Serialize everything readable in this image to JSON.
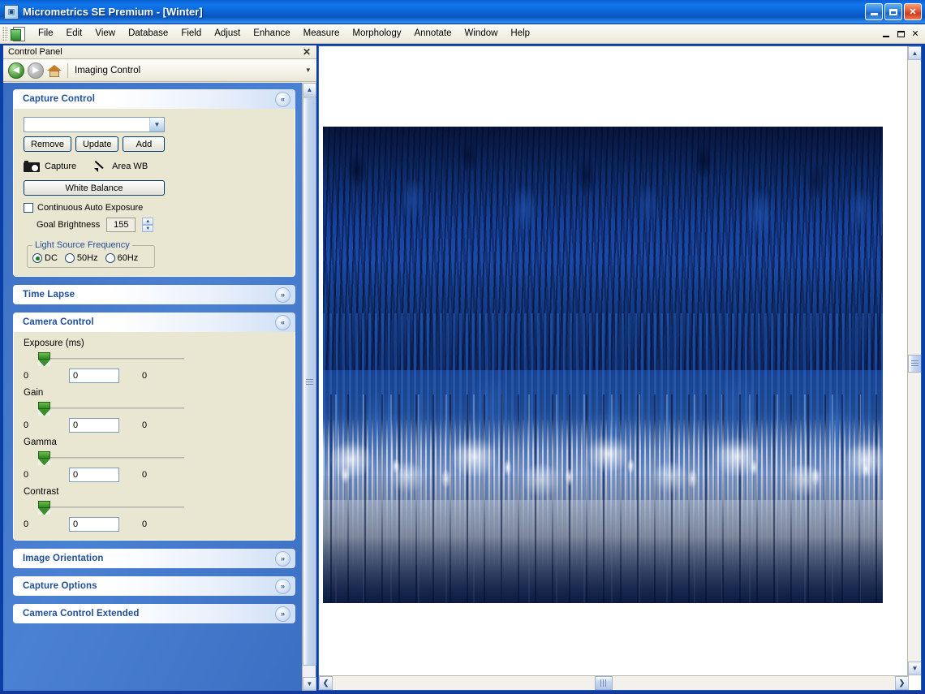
{
  "window": {
    "title": "Micrometrics SE Premium - [Winter]",
    "app_icon": "app-document-icon",
    "minimize_label": "",
    "maximize_label": "",
    "close_label": "✕"
  },
  "menubar": {
    "items": [
      {
        "label": "File"
      },
      {
        "label": "Edit"
      },
      {
        "label": "View"
      },
      {
        "label": "Database"
      },
      {
        "label": "Field"
      },
      {
        "label": "Adjust"
      },
      {
        "label": "Enhance"
      },
      {
        "label": "Measure"
      },
      {
        "label": "Morphology"
      },
      {
        "label": "Annotate"
      },
      {
        "label": "Window"
      },
      {
        "label": "Help"
      }
    ],
    "mdi_buttons": {
      "minimize": "",
      "restore": "",
      "close": "✕"
    }
  },
  "control_panel": {
    "title": "Control Panel",
    "close_label": "✕",
    "toolbar": {
      "back_label": "◀",
      "forward_label": "▶",
      "home_label": "",
      "current_view": "Imaging Control",
      "dropdown_caret": "▾"
    },
    "groups": [
      {
        "title": "Capture Control",
        "expanded": true,
        "chevron": "«",
        "combo": {
          "value": "",
          "placeholder": ""
        },
        "buttons": [
          {
            "label": "Remove"
          },
          {
            "label": "Update"
          },
          {
            "label": "Add"
          }
        ],
        "capture_label": "Capture",
        "area_wb_label": "Area WB",
        "white_balance_label": "White Balance",
        "continuous_auto_exposure": {
          "label": "Continuous Auto Exposure",
          "checked": false
        },
        "goal_brightness": {
          "label": "Goal Brightness",
          "value": "155"
        },
        "light_source_frequency": {
          "legend": "Light Source Frequency",
          "options": [
            {
              "label": "DC",
              "selected": true
            },
            {
              "label": "50Hz",
              "selected": false
            },
            {
              "label": "60Hz",
              "selected": false
            }
          ]
        }
      },
      {
        "title": "Time Lapse",
        "expanded": false,
        "chevron": "»"
      },
      {
        "title": "Camera Control",
        "expanded": true,
        "chevron": "«",
        "sliders": [
          {
            "label": "Exposure (ms)",
            "min": "0",
            "max": "0",
            "value": "0"
          },
          {
            "label": "Gain",
            "min": "0",
            "max": "0",
            "value": "0"
          },
          {
            "label": "Gamma",
            "min": "0",
            "max": "0",
            "value": "0"
          },
          {
            "label": "Contrast",
            "min": "0",
            "max": "0",
            "value": "0"
          }
        ]
      },
      {
        "title": "Image Orientation",
        "expanded": false,
        "chevron": "»"
      },
      {
        "title": "Capture Options",
        "expanded": false,
        "chevron": "»"
      },
      {
        "title": "Camera Control Extended",
        "expanded": false,
        "chevron": "»"
      }
    ],
    "scrollbar": {
      "up_label": "▲",
      "down_label": "▼"
    }
  },
  "document": {
    "name": "Winter",
    "image_alt": "winter-forest-photograph",
    "vscroll": {
      "up_label": "▲",
      "down_label": "▼"
    },
    "hscroll": {
      "left_label": "❮",
      "right_label": "❯"
    }
  },
  "colors": {
    "titlebar_blue": "#0b63d4",
    "panel_blue": "#3d73c9",
    "group_title_blue": "#1f4e9c",
    "panel_body_beige": "#e9e6d2",
    "accent_green": "#2f8a23",
    "close_red": "#cf3b1c"
  }
}
